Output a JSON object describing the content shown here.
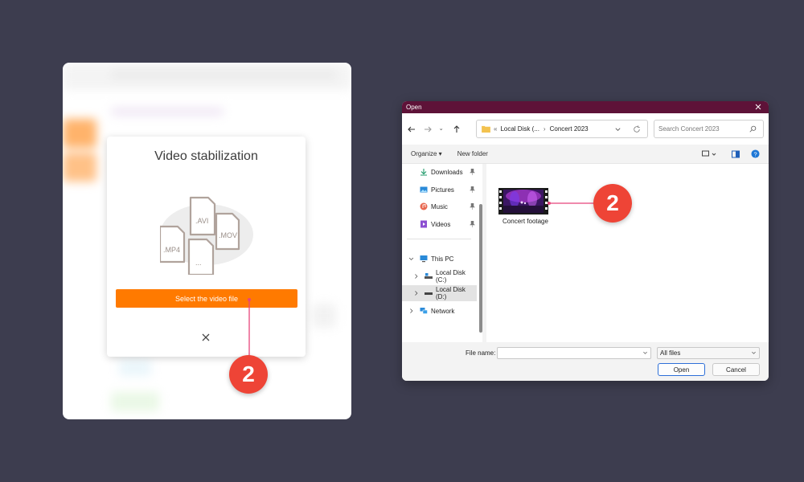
{
  "app": {
    "dialog_title": "Video stabilization",
    "file_types": [
      ".AVI",
      ".MOV",
      ".MP4",
      "..."
    ],
    "select_button_label": "Select the video file",
    "close_icon": "close-icon"
  },
  "callouts": {
    "left_step": "2",
    "right_step": "2",
    "color": "#ee4436"
  },
  "open_dialog": {
    "title": "Open",
    "breadcrumb": {
      "overflow": "«",
      "parent": "Local Disk (...",
      "separator": "›",
      "current": "Concert 2023"
    },
    "search_placeholder": "Search Concert 2023",
    "toolbar": {
      "organize_label": "Organize ▾",
      "new_folder_label": "New folder"
    },
    "nav_items": [
      {
        "label": "Downloads",
        "icon": "download-icon",
        "pinned": true
      },
      {
        "label": "Pictures",
        "icon": "pictures-icon",
        "pinned": true
      },
      {
        "label": "Music",
        "icon": "music-icon",
        "pinned": true
      },
      {
        "label": "Videos",
        "icon": "videos-icon",
        "pinned": true
      },
      {
        "label": "This PC",
        "icon": "pc-icon",
        "expanded": true
      },
      {
        "label": "Local Disk (C:)",
        "icon": "drive-icon"
      },
      {
        "label": "Local Disk (D:)",
        "icon": "drive-icon",
        "selected": true
      },
      {
        "label": "Network",
        "icon": "network-icon"
      }
    ],
    "files": [
      {
        "name": "Concert footage",
        "icon": "video-thumbnail"
      }
    ],
    "file_name_label": "File name:",
    "file_name_value": "",
    "file_type_value": "All files",
    "open_button": "Open",
    "cancel_button": "Cancel",
    "accent_color": "#5e1238"
  }
}
